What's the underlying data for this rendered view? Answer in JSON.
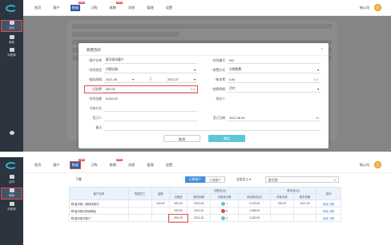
{
  "nav": {
    "items": [
      {
        "label": "首页"
      },
      {
        "label": "客户"
      },
      {
        "label": "数据",
        "badge": "NEW"
      },
      {
        "label": "订购"
      },
      {
        "label": "账期",
        "badge": "NEW"
      },
      {
        "label": "消息"
      },
      {
        "label": "管理"
      },
      {
        "label": "设置"
      }
    ],
    "account": "杨公司"
  },
  "sidebar": {
    "p1": [
      {
        "label": "合同"
      },
      {
        "label": "收款"
      },
      {
        "label": "对账单"
      }
    ],
    "p2": [
      {
        "label": "合同"
      },
      {
        "label": "收款"
      },
      {
        "label": "对账单"
      }
    ]
  },
  "modal": {
    "title": "新建合同",
    "customer_label": "客户名称",
    "customer": "星河测试客户",
    "type_label": "合同类型",
    "type": "代理记账",
    "period_label": "服务周期",
    "period_start": "2021-08",
    "period_sep": "至",
    "period_end": "2022-07",
    "amount_label": "记账费",
    "amount": "500.00",
    "amount_unit": "元/月",
    "total_label": "合同金额",
    "total": "6,000.00",
    "pay_label": "付款方式",
    "signer_label": "签订人",
    "remark_label": "备注",
    "no_label": "合同编号",
    "no": "002",
    "method_label": "收费方式",
    "method": "分期收费",
    "book_label": "账本费",
    "book": "0.00",
    "book_unit": "元/年",
    "way_label": "收费周期",
    "way": "月付",
    "handler_label": "经办人",
    "date_label": "签订日期",
    "date": "2021-08-24",
    "cancel": "取消",
    "ok": "确定"
  },
  "p2": {
    "toolbar_left": "下载",
    "tabs": [
      {
        "label": "记账客户"
      },
      {
        "label": "工商客户"
      }
    ],
    "filter": "全部员工",
    "search": "星河测",
    "headers": {
      "name": "客户名称",
      "staff": "所属员工",
      "amount": "金额",
      "group1": "记账费(元)",
      "group2": "账本费(元)",
      "op": "操作",
      "sub": [
        "记账费",
        "服务到期",
        "记账费月数",
        "未收款项(元)",
        "年账本费",
        "账本到期"
      ]
    },
    "rows": [
      {
        "name": "星河测一键转续测试",
        "staff": "",
        "amount": "100.00",
        "fee": "300.00",
        "due": "2022-03",
        "months": "7",
        "unpaid": "2,100.00",
        "book": "200.00",
        "bdue": "2021-02",
        "op1": "收费",
        "op2": "记账"
      },
      {
        "name": "星河测试转续期后",
        "staff": "",
        "amount": "",
        "fee": "333.00",
        "due": "2021-02",
        "months": "6",
        "unpaid": "1,998.00",
        "book": "",
        "bdue": "",
        "op1": "收费",
        "op2": "记账"
      },
      {
        "name": "星河测试客户",
        "staff": "",
        "amount": "",
        "fee": "500.00",
        "due": "2021-10",
        "months": "2",
        "unpaid": "1,000.00",
        "book": "",
        "bdue": "",
        "op1": "收费",
        "op2": "记账"
      }
    ]
  }
}
